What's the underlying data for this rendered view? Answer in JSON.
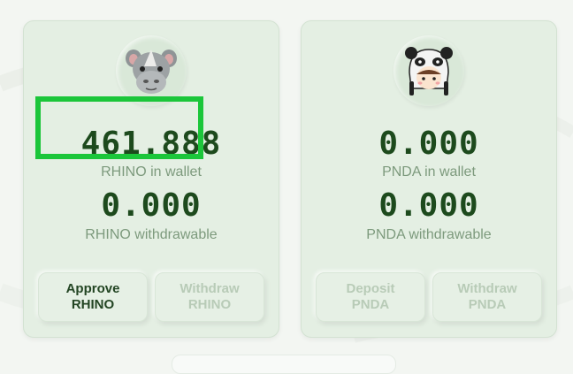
{
  "colors": {
    "accent": "#1bc63a",
    "balance_text": "#1d4a1d",
    "caption_text": "#7d9a7d",
    "card_bg": "#e4efe3"
  },
  "cards": [
    {
      "token": "RHINO",
      "avatar_icon": "rhino-icon",
      "wallet_balance": "461.888",
      "wallet_label": "RHINO in wallet",
      "withdrawable_balance": "0.000",
      "withdrawable_label": "RHINO withdrawable",
      "buttons": [
        {
          "label": "Approve\nRHINO",
          "enabled": true
        },
        {
          "label": "Withdraw\nRHINO",
          "enabled": false
        }
      ]
    },
    {
      "token": "PNDA",
      "avatar_icon": "panda-hat-icon",
      "wallet_balance": "0.000",
      "wallet_label": "PNDA in wallet",
      "withdrawable_balance": "0.000",
      "withdrawable_label": "PNDA withdrawable",
      "buttons": [
        {
          "label": "Deposit\nPNDA",
          "enabled": false
        },
        {
          "label": "Withdraw\nPNDA",
          "enabled": false
        }
      ]
    }
  ]
}
